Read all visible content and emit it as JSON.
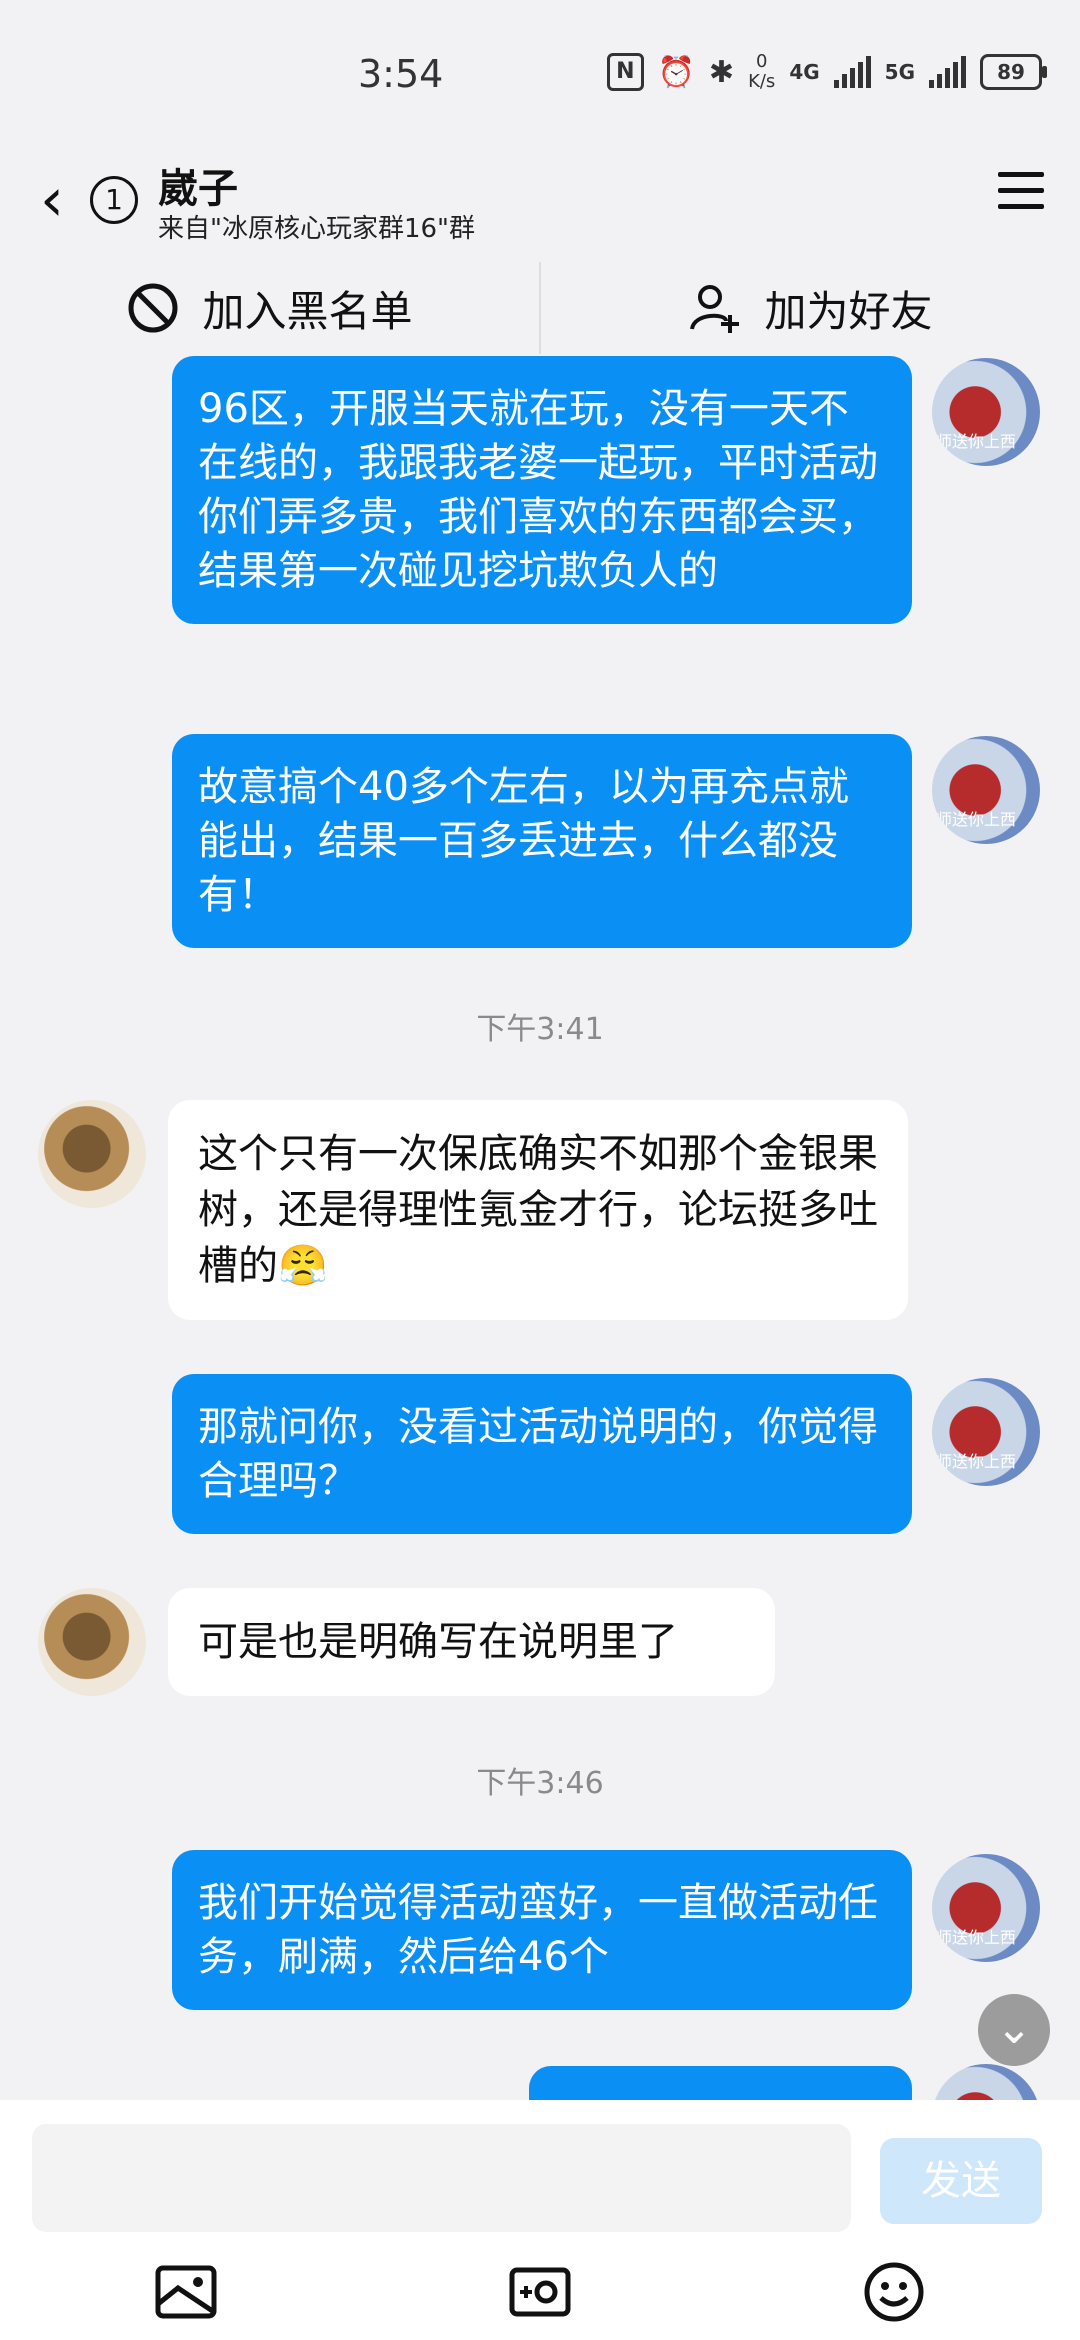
{
  "status_bar": {
    "time": "3:54",
    "nfc": "N",
    "speed": "0\nK/s",
    "net1": "4G",
    "net2": "5G",
    "battery": "89"
  },
  "header": {
    "back_icon": "chevron-left-icon",
    "unread_count": "1",
    "title": "崴子",
    "subtitle": "来自\"冰原核心玩家群16\"群",
    "menu_icon": "hamburger-menu-icon"
  },
  "actions": {
    "blacklist": "加入黑名单",
    "add_friend": "加为好友"
  },
  "messages": [
    {
      "side": "right",
      "text": "96区，开服当天就在玩，没有一天不在线的，我跟我老婆一起玩，平时活动你们弄多贵，我们喜欢的东西都会买，结果第一次碰见挖坑欺负人的"
    },
    {
      "side": "right",
      "text": "故意搞个40多个左右，以为再充点就能出，结果一百多丢进去，什么都没有！"
    },
    {
      "side": "time",
      "text": "下午3:41"
    },
    {
      "side": "left",
      "text": "这个只有一次保底确实不如那个金银果树，还是得理性氪金才行，论坛挺多吐槽的😤"
    },
    {
      "side": "right",
      "text": "那就问你，没看过活动说明的，你觉得合理吗？"
    },
    {
      "side": "left",
      "text": "可是也是明确写在说明里了"
    },
    {
      "side": "time",
      "text": "下午3:46"
    },
    {
      "side": "right",
      "text": "我们开始觉得活动蛮好，一直做活动任务，刷满，然后给46个"
    }
  ],
  "avatar_right_caption": "师送你上西",
  "input": {
    "placeholder": "",
    "send_label": "发送"
  },
  "toolbar_icons": [
    "image-icon",
    "camera-icon",
    "emoji-icon"
  ],
  "colors": {
    "bubble_right": "#0a8ff5",
    "bubble_left": "#ffffff",
    "background": "#f2f2f4"
  }
}
